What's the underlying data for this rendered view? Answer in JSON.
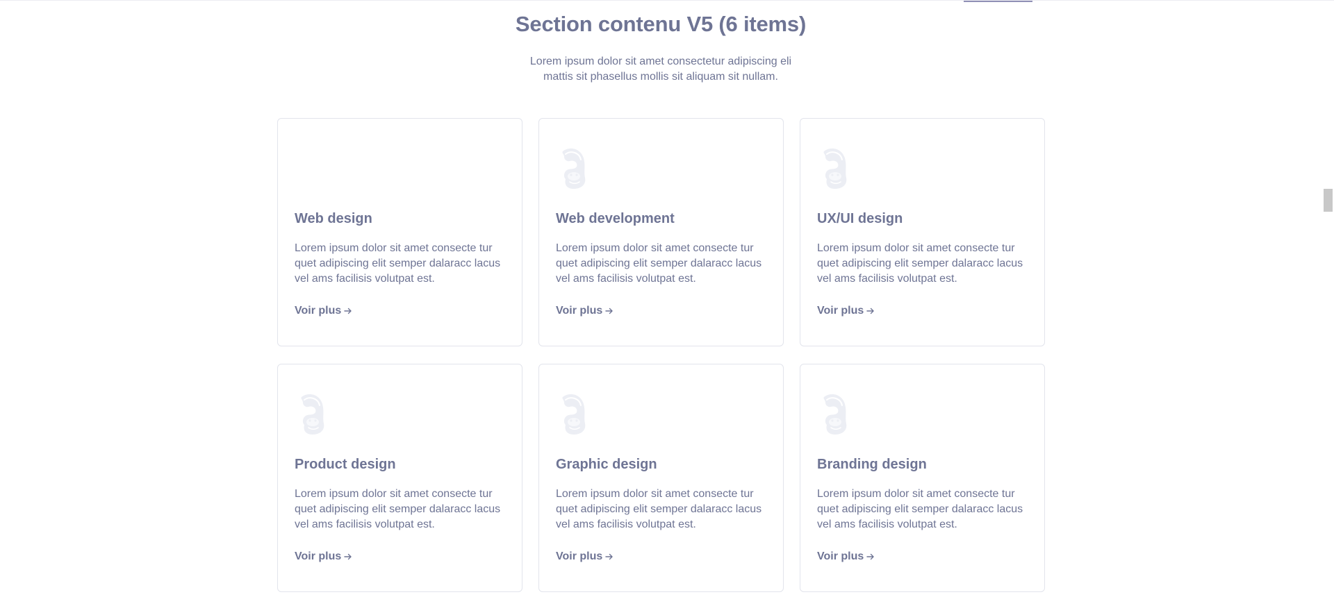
{
  "section": {
    "title": "Section contenu V5 (6 items)",
    "subtitle": "Lorem ipsum dolor sit amet consectetur adipiscing eli mattis sit phasellus mollis sit aliquam sit nullam."
  },
  "cards": [
    {
      "title": "Web design",
      "text": "Lorem ipsum dolor sit amet consecte tur quet adipiscing elit semper dalaracc lacus vel ams facilisis volutpat est.",
      "link": "Voir plus",
      "icon": "gorilla-icon",
      "icon_visible": false
    },
    {
      "title": "Web development",
      "text": "Lorem ipsum dolor sit amet consecte tur quet adipiscing elit semper dalaracc lacus vel ams facilisis volutpat est.",
      "link": "Voir plus",
      "icon": "gorilla-icon",
      "icon_visible": true
    },
    {
      "title": "UX/UI design",
      "text": "Lorem ipsum dolor sit amet consecte tur quet adipiscing elit semper dalaracc lacus vel ams facilisis volutpat est.",
      "link": "Voir plus",
      "icon": "gorilla-icon",
      "icon_visible": true
    },
    {
      "title": "Product design",
      "text": "Lorem ipsum dolor sit amet consecte tur quet adipiscing elit semper dalaracc lacus vel ams facilisis volutpat est.",
      "link": "Voir plus",
      "icon": "gorilla-icon",
      "icon_visible": true
    },
    {
      "title": "Graphic design",
      "text": "Lorem ipsum dolor sit amet consecte tur quet adipiscing elit semper dalaracc lacus vel ams facilisis volutpat est.",
      "link": "Voir plus",
      "icon": "gorilla-icon",
      "icon_visible": true
    },
    {
      "title": "Branding design",
      "text": "Lorem ipsum dolor sit amet consecte tur quet adipiscing elit semper dalaracc lacus vel ams facilisis volutpat est.",
      "link": "Voir plus",
      "icon": "gorilla-icon",
      "icon_visible": true
    }
  ],
  "colors": {
    "text": "#6e7494",
    "border": "#e2e4ec",
    "icon": "#eceef4",
    "accent": "#8f8fb5"
  }
}
